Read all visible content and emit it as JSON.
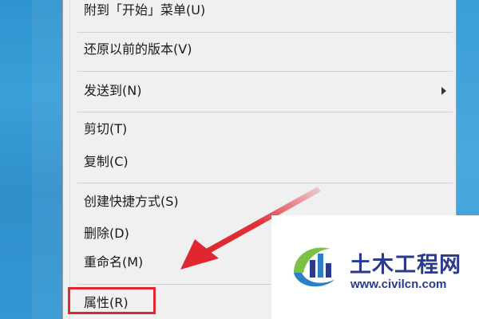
{
  "context_menu": {
    "items": [
      {
        "label": "附到「开始」菜单(U)"
      },
      {
        "label": "还原以前的版本(V)"
      },
      {
        "label": "发送到(N)"
      },
      {
        "label": "剪切(T)"
      },
      {
        "label": "复制(C)"
      },
      {
        "label": "创建快捷方式(S)"
      },
      {
        "label": "删除(D)"
      },
      {
        "label": "重命名(M)"
      },
      {
        "label": "属性(R)"
      }
    ]
  },
  "annotation": {
    "highlight_color": "#e0262f",
    "arrow_color": "#e0262f"
  },
  "watermark": {
    "title": "土木工程网",
    "url": "www.civilcn.com",
    "brand_color": "#2a3a8c"
  },
  "colors": {
    "desktop": "#3396d2",
    "menu_background": "#f0f0f0",
    "menu_text": "#1a1a1a"
  }
}
